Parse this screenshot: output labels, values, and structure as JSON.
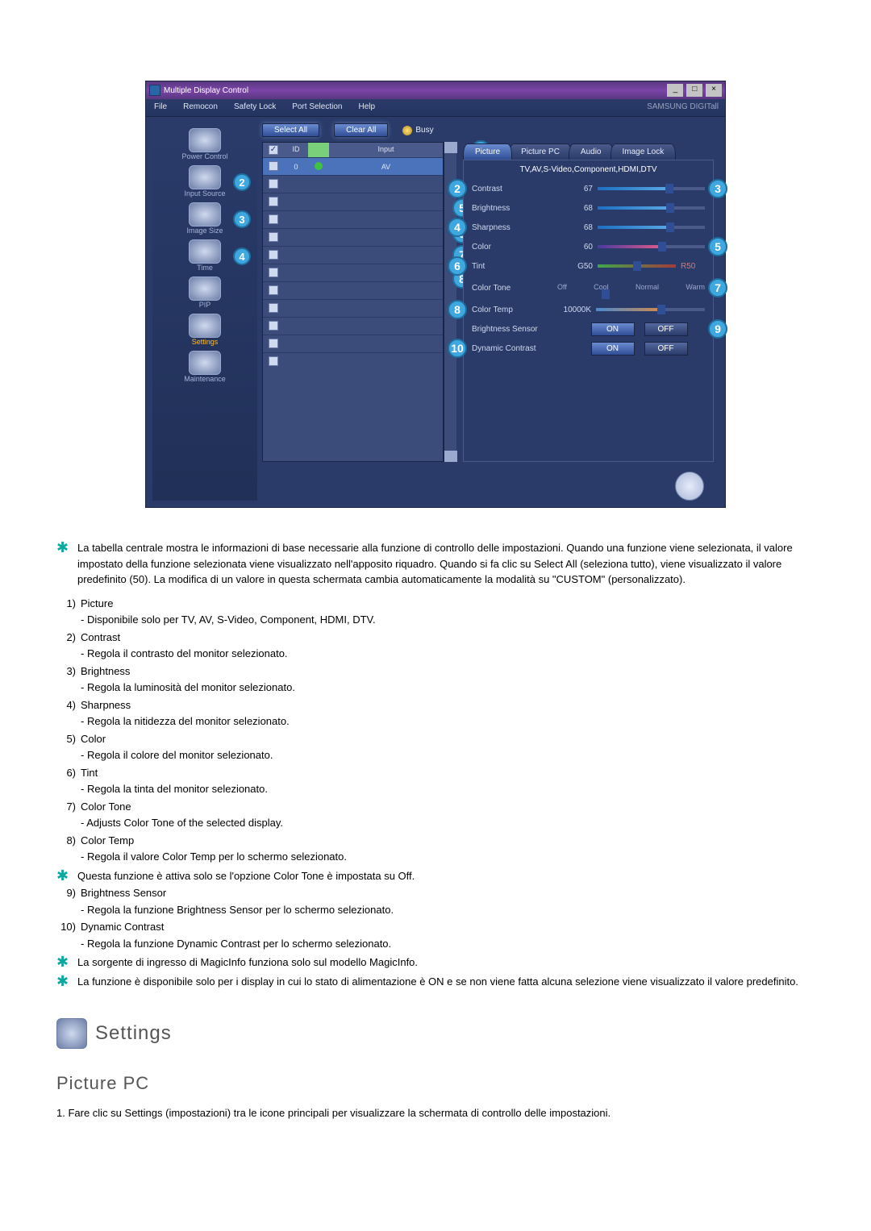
{
  "app": {
    "title": "Multiple Display Control",
    "brand": "SAMSUNG DIGITall",
    "menus": [
      "File",
      "Remocon",
      "Safety Lock",
      "Port Selection",
      "Help"
    ],
    "buttons": {
      "select_all": "Select All",
      "clear_all": "Clear All",
      "busy": "Busy"
    },
    "list_header": {
      "chk": "✓",
      "id": "ID",
      "status": "",
      "input": "Input"
    },
    "list_first_row": {
      "id": "0",
      "input": "AV"
    },
    "sidebar": [
      {
        "label": "Power Control",
        "active": false
      },
      {
        "label": "Input Source",
        "active": false,
        "badge": "2"
      },
      {
        "label": "Image Size",
        "active": false,
        "badge": "3"
      },
      {
        "label": "Time",
        "active": false,
        "badge": "4"
      },
      {
        "label": "PIP",
        "active": false
      },
      {
        "label": "Settings",
        "active": true
      },
      {
        "label": "Maintenance",
        "active": false
      }
    ],
    "tabs": [
      "Picture",
      "Picture PC",
      "Audio",
      "Image Lock"
    ],
    "source_list": "TV,AV,S-Video,Component,HDMI,DTV",
    "controls": {
      "contrast": {
        "label": "Contrast",
        "value": "67"
      },
      "brightness": {
        "label": "Brightness",
        "value": "68"
      },
      "sharpness": {
        "label": "Sharpness",
        "value": "68"
      },
      "color": {
        "label": "Color",
        "value": "60"
      },
      "tint": {
        "label": "Tint",
        "value": "G50",
        "right": "R50"
      },
      "color_tone": {
        "label": "Color Tone",
        "opts": [
          "Off",
          "Cool",
          "Normal",
          "Warm"
        ]
      },
      "color_temp": {
        "label": "Color Temp",
        "value": "10000K"
      },
      "bright_sensor": {
        "label": "Brightness Sensor",
        "on": "ON",
        "off": "OFF"
      },
      "dyn_contrast": {
        "label": "Dynamic Contrast",
        "on": "ON",
        "off": "OFF"
      }
    },
    "callouts": {
      "tab_picture": "1",
      "contrast_l": "2",
      "contrast_r": "3",
      "sharp_l": "4",
      "color_r": "5",
      "tint_l": "6",
      "tone_r": "7",
      "temp_l": "8",
      "sensor_r": "9",
      "dyn_l": "10",
      "mid5": "5",
      "mid6": "6",
      "mid7": "7",
      "mid8": "8"
    }
  },
  "intro_star": "La tabella centrale mostra le informazioni di base necessarie alla funzione di controllo delle impostazioni. Quando una funzione viene selezionata, il valore impostato della funzione selezionata viene visualizzato nell'apposito riquadro. Quando si fa clic su Select All (seleziona tutto), viene visualizzato il valore predefinito (50). La modifica di un valore in questa schermata cambia automaticamente la modalità su \"CUSTOM\" (personalizzato).",
  "items": [
    {
      "n": "1)",
      "title": "Picture",
      "sub": "Disponibile solo per TV, AV, S-Video, Component, HDMI, DTV."
    },
    {
      "n": "2)",
      "title": "Contrast",
      "sub": "Regola il contrasto del monitor selezionato."
    },
    {
      "n": "3)",
      "title": "Brightness",
      "sub": "Regola la luminosità del monitor selezionato."
    },
    {
      "n": "4)",
      "title": "Sharpness",
      "sub": "Regola la nitidezza del monitor selezionato."
    },
    {
      "n": "5)",
      "title": "Color",
      "sub": "Regola il colore del monitor selezionato."
    },
    {
      "n": "6)",
      "title": "Tint",
      "sub": "Regola la tinta del monitor selezionato."
    },
    {
      "n": "7)",
      "title": "Color Tone",
      "sub": "Adjusts Color Tone of the selected display."
    },
    {
      "n": "8)",
      "title": "Color Temp",
      "sub": "Regola il valore Color Temp per lo schermo selezionato."
    }
  ],
  "star_after_8": "Questa funzione è attiva solo se l'opzione Color Tone è impostata su Off.",
  "items_tail": [
    {
      "n": "9)",
      "title": "Brightness Sensor",
      "sub": "Regola la funzione Brightness Sensor per lo schermo selezionato."
    },
    {
      "n": "10)",
      "title": "Dynamic Contrast",
      "sub": "Regola la funzione Dynamic Contrast per lo schermo selezionato."
    }
  ],
  "star_notes_tail": [
    "La sorgente di ingresso di MagicInfo funziona solo sul modello MagicInfo.",
    "La funzione è disponibile solo per i display in cui lo stato di alimentazione è ON e se non viene fatta alcuna selezione viene visualizzato il valore predefinito."
  ],
  "section_header": "Settings",
  "sub_header": "Picture PC",
  "bottom_step": "1. Fare clic su Settings (impostazioni) tra le icone principali per visualizzare la schermata di controllo delle impostazioni."
}
